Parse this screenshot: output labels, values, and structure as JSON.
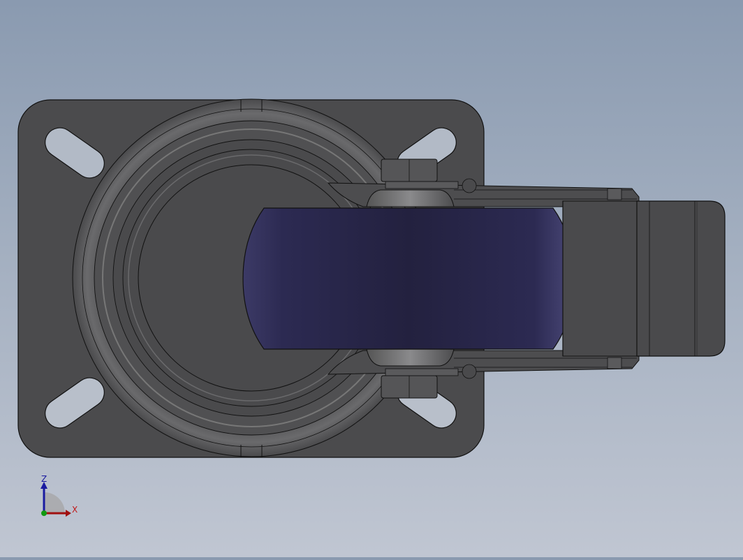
{
  "triad": {
    "z_label": "Z",
    "x_label": "X",
    "z_color": "#1a1aa0",
    "x_color": "#c01818",
    "y_color": "#119911"
  },
  "colors": {
    "background_top": "#8a9ab0",
    "background_bottom": "#c0c6d2",
    "metal": "#4a4a4c",
    "metal_dark": "#333335",
    "wheel": "#2a2850",
    "wheel_highlight": "#4a4878",
    "outline": "#111111"
  }
}
